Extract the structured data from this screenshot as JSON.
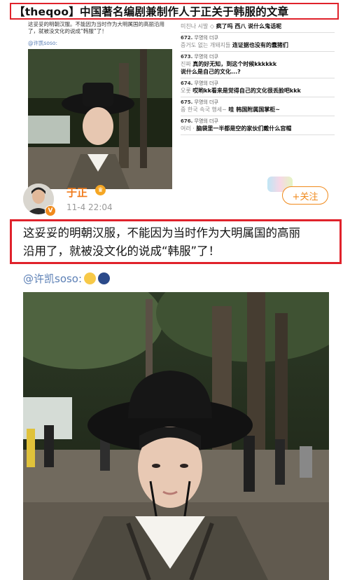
{
  "banner": {
    "title": "【theqoo】中国著名编剧兼制作人于正关于韩服的文章"
  },
  "mini_post": {
    "caption": "这妥妥的明朝汉服。不能因为当时作为大明属国的高丽沿用了，就被没文化的说成“韩服”了！",
    "mention": "@许凯soso:"
  },
  "comments": [
    {
      "head": "",
      "user": "",
      "korean": "미친나 시발 ◇",
      "text": "疯了吗 西八 说什么鬼话呢"
    },
    {
      "head": "672.",
      "user": "무명의 더쿠",
      "korean": "증거도 없는 개돼지들",
      "text": "连证据也没有的蠢猪们"
    },
    {
      "head": "673.",
      "user": "무명의 더쿠",
      "korean": "진짜",
      "text": "真的好无知，到这个时候kkkkkk",
      "text2": "说什么是自己的文化...?"
    },
    {
      "head": "674.",
      "user": "무명의 더쿠",
      "korean": "오롯",
      "text": "哎哟kk看来是觉得自己的文化很丢脸吧kkk"
    },
    {
      "head": "675.",
      "user": "무명의 더쿠",
      "korean": "중 한국 속국 행세~",
      "text": "哇 韩国附属国掌柜~"
    },
    {
      "head": "676.",
      "user": "무명의 더쿠",
      "korean": "여러 ·",
      "text": "脑袋里一半都是空的家伙们戴什么宫帽"
    }
  ],
  "post": {
    "username": "于正",
    "time": "11-4 22:04",
    "follow_label": "+关注",
    "verified_mark": "V",
    "caption_line1": "这妥妥的明朝汉服，不能因为当时作为大明属国的高丽",
    "caption_line2": "沿用了，就被没文化的说成“韩服”了！",
    "mention": "@许凯soso:"
  },
  "icons": {
    "think_emoji": "thinking-emoji-icon",
    "moon_emoji": "moon-emoji-icon",
    "crown": "crown-badge-icon"
  },
  "colors": {
    "highlight_border": "#e0222b",
    "accent": "#f08a1c",
    "link": "#5b7fb5"
  }
}
